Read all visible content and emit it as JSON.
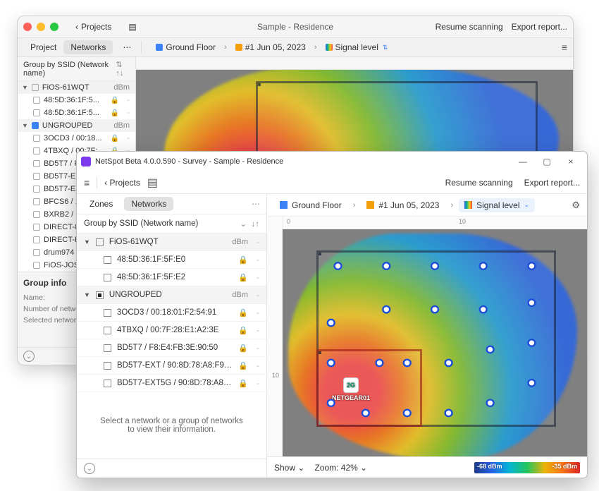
{
  "mac": {
    "title": "Sample - Residence",
    "back_label": "Projects",
    "resume": "Resume scanning",
    "export": "Export report...",
    "tabs": {
      "project": "Project",
      "networks": "Networks"
    },
    "group_by": "Group by SSID (Network name)",
    "breadcrumb": {
      "floor": "Ground Floor",
      "snapshot": "#1 Jun 05, 2023",
      "viz": "Signal level"
    },
    "dbm_label": "dBm",
    "groups": [
      {
        "name": "FiOS-61WQT",
        "items": [
          {
            "name": "48:5D:36:1F:5...",
            "locked": true
          },
          {
            "name": "48:5D:36:1F:5...",
            "locked": true
          }
        ]
      },
      {
        "name": "UNGROUPED",
        "filled": true,
        "items": [
          {
            "name": "3OCD3 / 00:18...",
            "locked": true
          },
          {
            "name": "4TBXQ / 00:7F:...",
            "locked": true
          },
          {
            "name": "BD5T7 / F8:E4:...",
            "locked": true
          },
          {
            "name": "BD5T7-EXT / 9...",
            "locked": true
          },
          {
            "name": "BD5T7-EXT5G...",
            "locked": true
          },
          {
            "name": "BFCS6 / 18:9C...",
            "locked": true
          },
          {
            "name": "BXRB2 / 18:9C...",
            "locked": true
          },
          {
            "name": "DIRECT-81-HP...",
            "locked": true
          },
          {
            "name": "DIRECT-KT-Fir...",
            "locked": true
          },
          {
            "name": "drum974 / 00:...",
            "locked": true
          },
          {
            "name": "FiOS-JOSM8 /...",
            "locked": true
          }
        ]
      }
    ],
    "info": {
      "title": "Group info",
      "name_label": "Name:",
      "count_label": "Number of networks:",
      "sel_label": "Selected networks:"
    }
  },
  "win": {
    "title": "NetSpot Beta 4.0.0.590 - Survey - Sample - Residence",
    "back_label": "Projects",
    "resume": "Resume scanning",
    "export": "Export report...",
    "tabs": {
      "zones": "Zones",
      "networks": "Networks"
    },
    "group_by": "Group by SSID (Network name)",
    "dbm_label": "dBm",
    "groups": [
      {
        "name": "FiOS-61WQT",
        "items": [
          {
            "name": "48:5D:36:1F:5F:E0",
            "locked": true
          },
          {
            "name": "48:5D:36:1F:5F:E2",
            "locked": true
          }
        ]
      },
      {
        "name": "UNGROUPED",
        "filled": true,
        "items": [
          {
            "name": "3OCD3 / 00:18:01:F2:54:91",
            "locked": true
          },
          {
            "name": "4TBXQ / 00:7F:28:E1:A2:3E",
            "locked": true
          },
          {
            "name": "BD5T7 / F8:E4:FB:3E:90:50",
            "locked": true
          },
          {
            "name": "BD5T7-EXT / 90:8D:78:A8:F9:5A",
            "locked": true
          },
          {
            "name": "BD5T7-EXT5G / 90:8D:78:A8:F9:5C",
            "locked": true
          }
        ]
      }
    ],
    "placeholder": "Select a network or a group of networks to view their information.",
    "breadcrumb": {
      "floor": "Ground Floor",
      "snapshot": "#1 Jun 05, 2023",
      "viz": "Signal level"
    },
    "ruler": {
      "h0": "0",
      "h10": "10",
      "v10": "10"
    },
    "ap": {
      "band": "2G",
      "name": "NETGEAR01"
    },
    "status": {
      "show": "Show",
      "zoom": "Zoom: 42%",
      "legend_min": "-68 dBm",
      "legend_max": "-35 dBm"
    }
  }
}
